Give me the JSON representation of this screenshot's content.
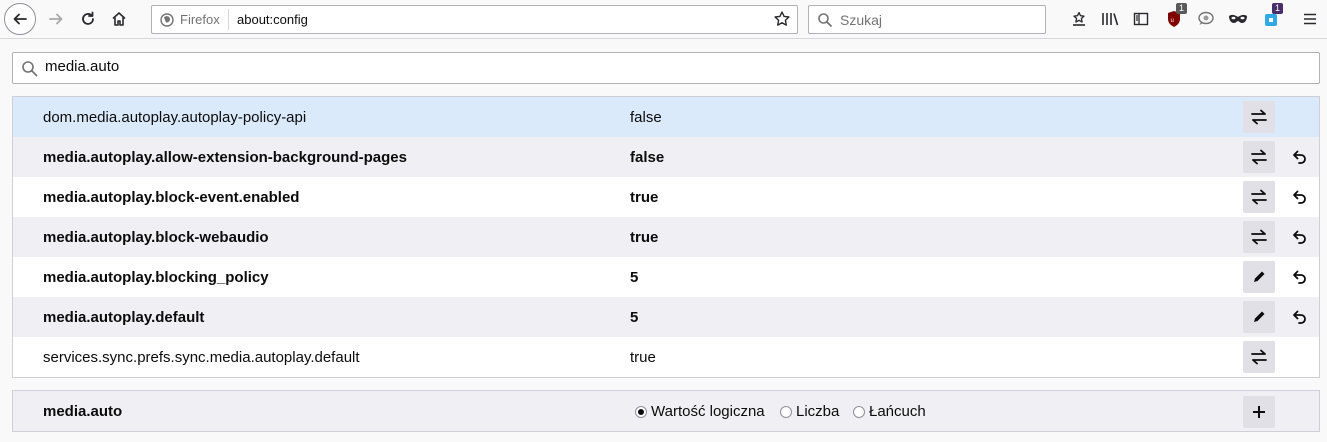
{
  "toolbar": {
    "identity_label": "Firefox",
    "url": "about:config",
    "search_placeholder": "Szukaj",
    "ublock_badge": "1",
    "ext_badge": "1"
  },
  "filter": {
    "value": "media.auto"
  },
  "prefs": [
    {
      "name": "dom.media.autoplay.autoplay-policy-api",
      "value": "false",
      "modified": false,
      "action": "toggle",
      "selected": true
    },
    {
      "name": "media.autoplay.allow-extension-background-pages",
      "value": "false",
      "modified": true,
      "action": "toggle"
    },
    {
      "name": "media.autoplay.block-event.enabled",
      "value": "true",
      "modified": true,
      "action": "toggle"
    },
    {
      "name": "media.autoplay.block-webaudio",
      "value": "true",
      "modified": true,
      "action": "toggle"
    },
    {
      "name": "media.autoplay.blocking_policy",
      "value": "5",
      "modified": true,
      "action": "edit"
    },
    {
      "name": "media.autoplay.default",
      "value": "5",
      "modified": true,
      "action": "edit"
    },
    {
      "name": "services.sync.prefs.sync.media.autoplay.default",
      "value": "true",
      "modified": false,
      "action": "toggle"
    }
  ],
  "add_row": {
    "name": "media.auto",
    "types": [
      "Wartość logiczna",
      "Liczba",
      "Łańcuch"
    ],
    "selected_type": "Wartość logiczna"
  },
  "colors": {
    "selected_row": "#dbeafb",
    "alt_row": "#f0f0f4",
    "button": "#e0e0e6"
  }
}
